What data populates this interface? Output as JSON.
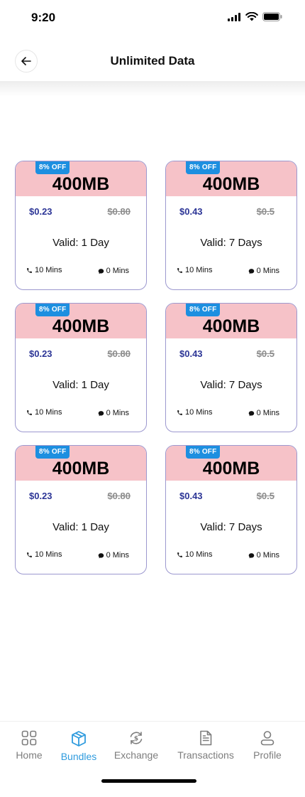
{
  "status_bar": {
    "time": "9:20"
  },
  "header": {
    "title": "Unlimited Data"
  },
  "bundles": [
    {
      "discount": "8% OFF",
      "data": "400MB",
      "price": "$0.23",
      "old_price": "$0.80",
      "validity": "Valid: 1 Day",
      "calls": "10 Mins",
      "sms": "0 Mins"
    },
    {
      "discount": "8% OFF",
      "data": "400MB",
      "price": "$0.43",
      "old_price": "$0.5",
      "validity": "Valid: 7 Days",
      "calls": "10 Mins",
      "sms": "0 Mins"
    },
    {
      "discount": "8% OFF",
      "data": "400MB",
      "price": "$0.23",
      "old_price": "$0.80",
      "validity": "Valid: 1 Day",
      "calls": "10 Mins",
      "sms": "0 Mins"
    },
    {
      "discount": "8% OFF",
      "data": "400MB",
      "price": "$0.43",
      "old_price": "$0.5",
      "validity": "Valid: 7 Days",
      "calls": "10 Mins",
      "sms": "0 Mins"
    },
    {
      "discount": "8% OFF",
      "data": "400MB",
      "price": "$0.23",
      "old_price": "$0.80",
      "validity": "Valid: 1 Day",
      "calls": "10 Mins",
      "sms": "0 Mins"
    },
    {
      "discount": "8% OFF",
      "data": "400MB",
      "price": "$0.43",
      "old_price": "$0.5",
      "validity": "Valid: 7 Days",
      "calls": "10 Mins",
      "sms": "0 Mins"
    }
  ],
  "nav": [
    {
      "label": "Home",
      "icon": "grid-icon"
    },
    {
      "label": "Bundles",
      "icon": "box-icon",
      "active": true
    },
    {
      "label": "Exchange",
      "icon": "exchange-icon"
    },
    {
      "label": "Transactions",
      "icon": "document-icon"
    },
    {
      "label": "Profile",
      "icon": "user-icon"
    }
  ],
  "colors": {
    "card_header": "#f6c2c8",
    "badge": "#1d8fe0",
    "price": "#2c3596",
    "card_border": "#9c98cf",
    "active_nav": "#2f9bde"
  }
}
